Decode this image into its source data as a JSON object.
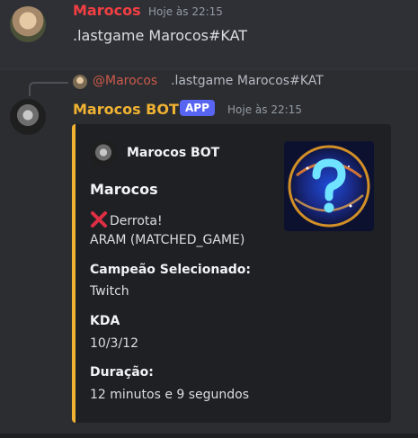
{
  "message1": {
    "username": "Marocos",
    "timestamp": "Hoje às 22:15",
    "content": ".lastgame Marocos#KAT"
  },
  "reply": {
    "mention": "@Marocos",
    "content": ".lastgame Marocos#KAT"
  },
  "message2": {
    "username": "Marocos BOT",
    "badge": "APP",
    "timestamp": "Hoje às 22:15",
    "embed": {
      "accent_color": "#f0b232",
      "author_name": "Marocos BOT",
      "title": "Marocos",
      "result": "Derrota!",
      "result_icon": "x-mark-icon",
      "mode": "ARAM (MATCHED_GAME)",
      "fields": [
        {
          "name": "Campeão Selecionado:",
          "value": "Twitch"
        },
        {
          "name": "KDA",
          "value": "10/3/12"
        },
        {
          "name": "Duração:",
          "value": "12 minutos e 9 segundos"
        }
      ],
      "thumbnail_icon": "question-mark-icon"
    }
  },
  "colors": {
    "username1": "#f23f43",
    "username2": "#f0b232",
    "badge": "#5865f2",
    "background": "#313338"
  }
}
